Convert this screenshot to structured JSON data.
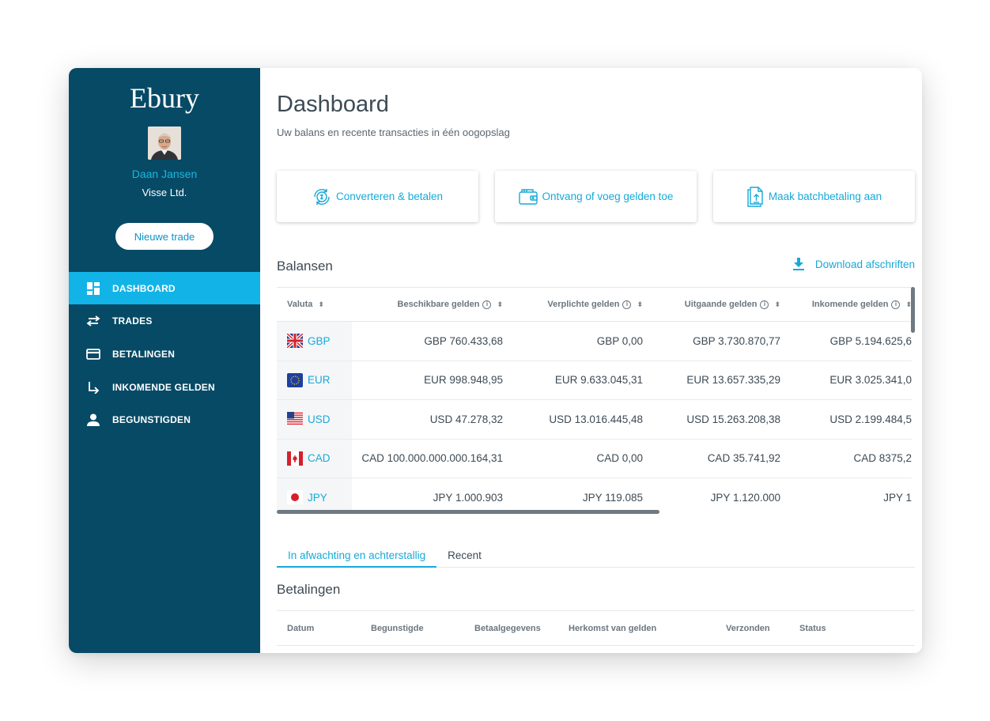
{
  "sidebar": {
    "logo": "Ebury",
    "user_name": "Daan Jansen",
    "company": "Visse Ltd.",
    "new_trade_label": "Nieuwe trade",
    "nav": [
      {
        "label": "DASHBOARD",
        "icon": "dashboard-icon",
        "active": true
      },
      {
        "label": "TRADES",
        "icon": "swap-arrows-icon",
        "active": false
      },
      {
        "label": "BETALINGEN",
        "icon": "credit-card-icon",
        "active": false
      },
      {
        "label": "INKOMENDE GELDEN",
        "icon": "arrow-down-right-icon",
        "active": false
      },
      {
        "label": "BEGUNSTIGDEN",
        "icon": "person-icon",
        "active": false
      }
    ]
  },
  "header": {
    "title": "Dashboard",
    "subtitle": "Uw balans en recente transacties in één oogopslag"
  },
  "actions": [
    {
      "label": "Converteren & betalen",
      "icon": "convert-coin-icon"
    },
    {
      "label": "Ontvang of voeg gelden toe",
      "icon": "wallet-icon"
    },
    {
      "label": "Maak batchbetaling aan",
      "icon": "batch-upload-icon"
    }
  ],
  "balances": {
    "title": "Balansen",
    "download_label": "Download afschriften",
    "columns": [
      "Valuta",
      "Beschikbare gelden",
      "Verplichte gelden",
      "Uitgaande gelden",
      "Inkomende gelden"
    ],
    "rows": [
      {
        "code": "GBP",
        "flag": "uk-flag-icon",
        "available": "GBP 760.433,68",
        "required": "GBP 0,00",
        "outgoing": "GBP 3.730.870,77",
        "incoming": "GBP 5.194.625,6"
      },
      {
        "code": "EUR",
        "flag": "eu-flag-icon",
        "available": "EUR 998.948,95",
        "required": "EUR 9.633.045,31",
        "outgoing": "EUR 13.657.335,29",
        "incoming": "EUR 3.025.341,0"
      },
      {
        "code": "USD",
        "flag": "us-flag-icon",
        "available": "USD 47.278,32",
        "required": "USD 13.016.445,48",
        "outgoing": "USD 15.263.208,38",
        "incoming": "USD 2.199.484,5"
      },
      {
        "code": "CAD",
        "flag": "ca-flag-icon",
        "available": "CAD 100.000.000.000.164,31",
        "required": "CAD 0,00",
        "outgoing": "CAD 35.741,92",
        "incoming": "CAD 8375,2"
      },
      {
        "code": "JPY",
        "flag": "jp-flag-icon",
        "available": "JPY 1.000.903",
        "required": "JPY 119.085",
        "outgoing": "JPY 1.120.000",
        "incoming": "JPY 1"
      }
    ]
  },
  "tabs": [
    {
      "label": "In afwachting en achterstallig",
      "active": true
    },
    {
      "label": "Recent",
      "active": false
    }
  ],
  "payments": {
    "title": "Betalingen",
    "columns": [
      "Datum",
      "Begunstigde",
      "Betaalgegevens",
      "Herkomst van gelden",
      "Verzonden",
      "Status"
    ]
  },
  "colors": {
    "sidebar_bg": "#074a66",
    "active_nav": "#12b4e8",
    "accent": "#17a9d8"
  }
}
